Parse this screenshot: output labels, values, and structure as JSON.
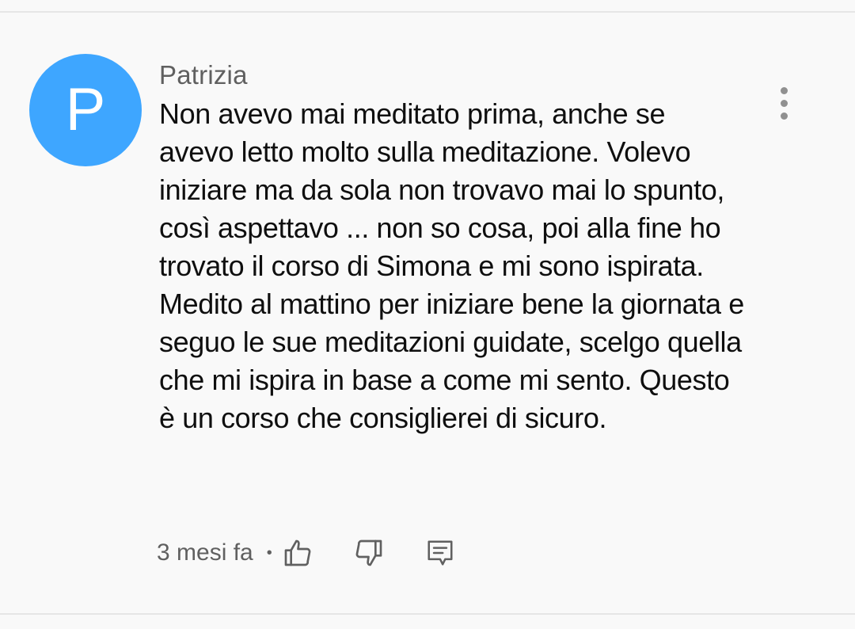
{
  "comment": {
    "avatar_letter": "P",
    "avatar_color": "#3ea6ff",
    "author": "Patrizia",
    "text": "Non avevo mai meditato prima, anche se avevo letto molto sulla meditazione. Volevo iniziare ma da sola non trovavo mai lo spunto, così aspettavo ... non so cosa, poi alla fine ho trovato il corso di Simona e mi sono ispirata. Medito al mattino per iniziare bene la giornata e seguo le sue meditazioni guidate, scelgo quella che mi ispira in base a come mi sento. Questo è un corso che consiglierei di sicuro.",
    "time": "3 mesi fa",
    "separator": "•",
    "icons": {
      "menu": "more-vert-icon",
      "like": "thumb-up-icon",
      "dislike": "thumb-down-icon",
      "reply": "reply-comment-icon"
    }
  }
}
